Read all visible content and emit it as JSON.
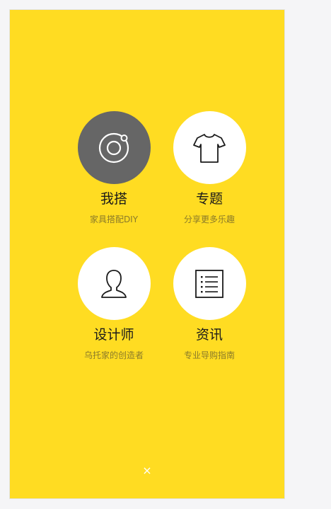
{
  "menu": {
    "items": [
      {
        "title": "我搭",
        "subtitle": "家具搭配DIY",
        "icon": "target-icon",
        "active": true
      },
      {
        "title": "专题",
        "subtitle": "分享更多乐趣",
        "icon": "tshirt-icon",
        "active": false
      },
      {
        "title": "设计师",
        "subtitle": "乌托家的创造者",
        "icon": "user-icon",
        "active": false
      },
      {
        "title": "资讯",
        "subtitle": "专业导购指南",
        "icon": "list-icon",
        "active": false
      }
    ]
  },
  "close": {
    "label": "×"
  },
  "colors": {
    "background": "#FFDC22",
    "active_circle": "#666666",
    "circle": "#FFFFFF"
  }
}
